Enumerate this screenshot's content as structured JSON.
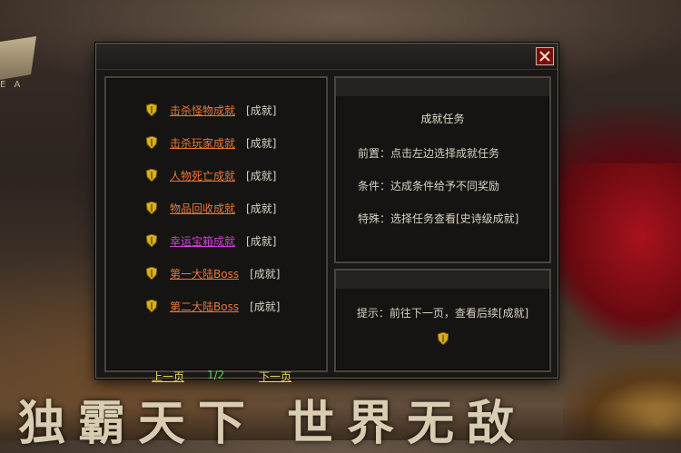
{
  "background": {
    "logo_sub": "E A",
    "banner_text": "独霸天下 世界无敌"
  },
  "dialog": {
    "close_icon": "close-icon"
  },
  "achievements": [
    {
      "label": "击杀怪物成就",
      "tag": "[成就]",
      "color": "#e87838"
    },
    {
      "label": "击杀玩家成就",
      "tag": "[成就]",
      "color": "#e87838"
    },
    {
      "label": "人物死亡成就",
      "tag": "[成就]",
      "color": "#e87838"
    },
    {
      "label": "物品回收成就",
      "tag": "[成就]",
      "color": "#e87838"
    },
    {
      "label": "幸运宝箱成就",
      "tag": "[成就]",
      "color": "#d040d8"
    },
    {
      "label": "第一大陆Boss",
      "tag": "[成就]",
      "color": "#e87838"
    },
    {
      "label": "第二大陆Boss",
      "tag": "[成就]",
      "color": "#e87838"
    }
  ],
  "pager": {
    "prev": "上一页",
    "page": "1/2",
    "next": "下一页"
  },
  "task": {
    "title": "成就任务",
    "prereq": "前置：点击左边选择成就任务",
    "condition": "条件：达成条件给予不同奖励",
    "special": "特殊：选择任务查看[史诗级成就]"
  },
  "hint": {
    "text": "提示：前往下一页，查看后续[成就]",
    "icon": "shield-icon"
  },
  "colors": {
    "link_orange": "#e87838",
    "link_magenta": "#d040d8",
    "pager_yellow": "#e8d860",
    "pager_green": "#5ed05e",
    "shield_gold": "#d8b020"
  }
}
